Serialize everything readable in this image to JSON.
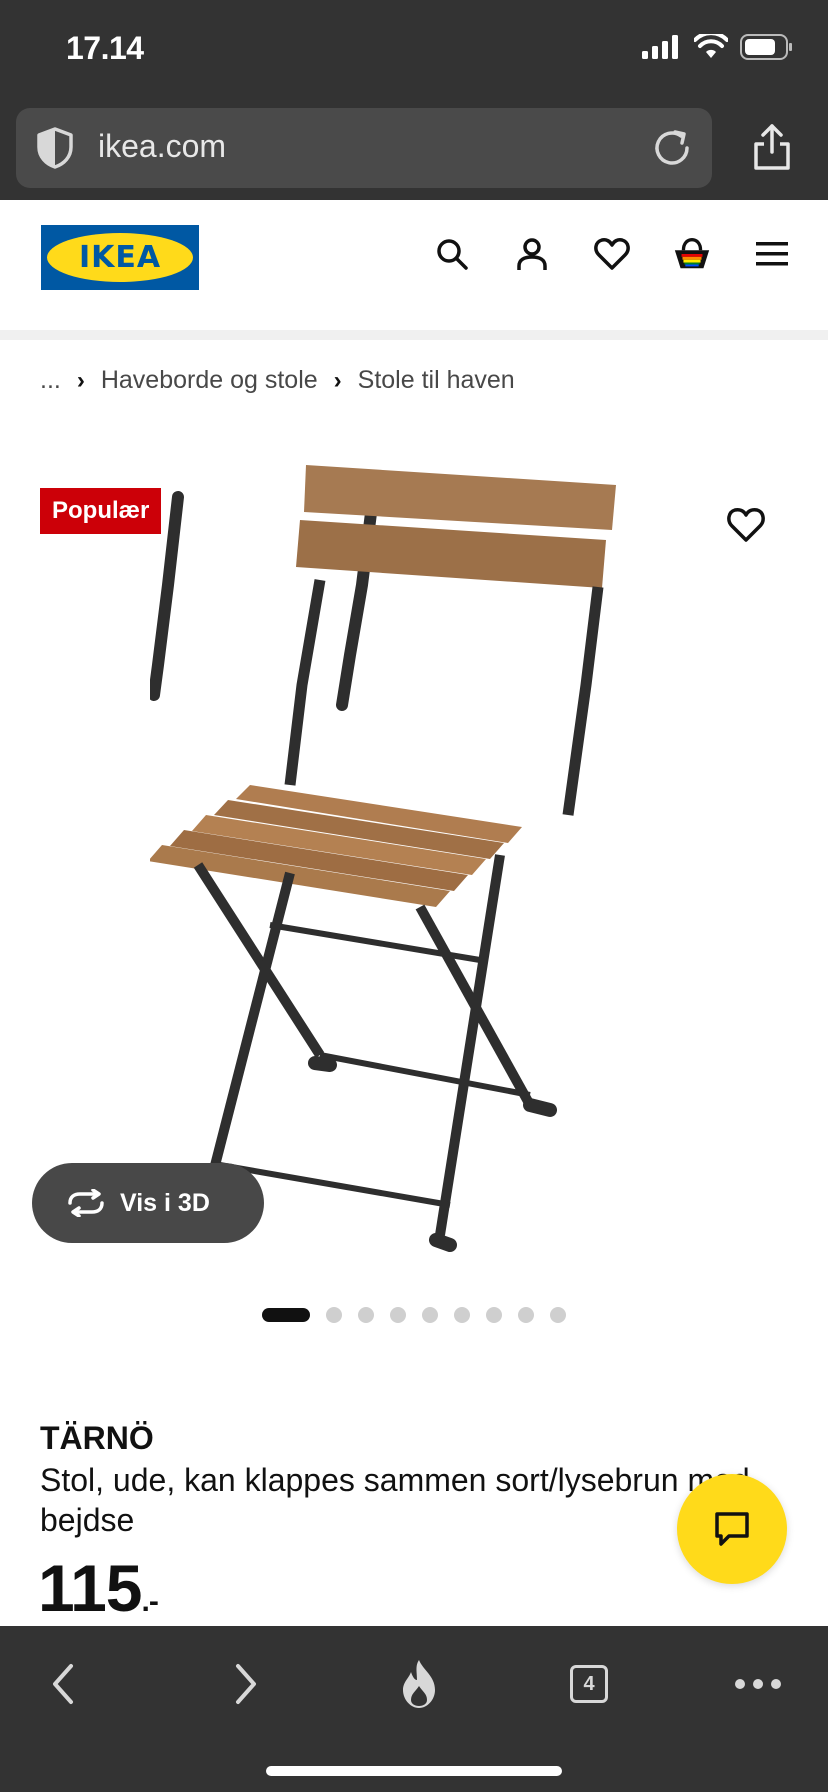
{
  "status_bar": {
    "time": "17.14"
  },
  "browser": {
    "url": "ikea.com",
    "tab_count": "4",
    "icons": [
      "shield-icon",
      "reload-icon",
      "share-icon",
      "back-icon",
      "forward-icon",
      "fire-icon",
      "tabs-icon",
      "more-icon"
    ]
  },
  "header": {
    "logo_text": "IKEA",
    "icons": [
      "search-icon",
      "account-icon",
      "heart-icon",
      "basket-icon",
      "menu-icon"
    ]
  },
  "breadcrumb": {
    "items": [
      "...",
      "Haveborde og stole",
      "Stole til haven"
    ]
  },
  "product": {
    "badge": "Populær",
    "vis3d_label": "Vis i 3D",
    "name": "TÄRNÖ",
    "description": "Stol, ude, kan klappes sammen sort/lysebrun med bejdse",
    "price_main": "115",
    "price_suffix": ".-",
    "image_count": 9,
    "active_image": 1
  },
  "colors": {
    "chrome": "#333333",
    "ikea_blue": "#0058a3",
    "ikea_yellow": "#ffda1a",
    "badge_red": "#cc0008"
  }
}
